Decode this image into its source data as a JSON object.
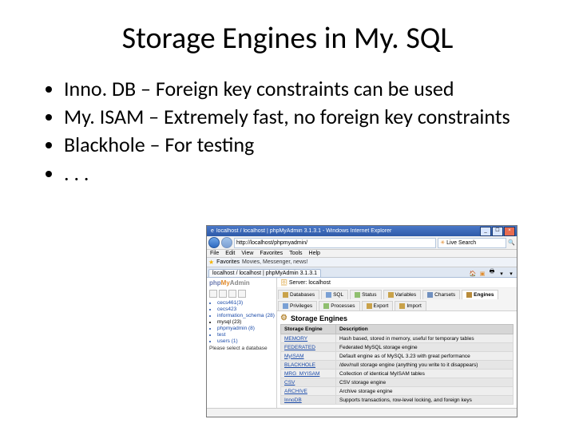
{
  "slide": {
    "title": "Storage Engines in My. SQL",
    "bullets": [
      "Inno. DB – Foreign key constraints can be used",
      "My. ISAM – Extremely fast, no foreign key constraints",
      "Blackhole – For testing",
      ". . ."
    ]
  },
  "window": {
    "title": "localhost / localhost | phpMyAdmin 3.1.3.1 - Windows Internet Explorer",
    "address": "http://localhost/phpmyadmin/",
    "search_placeholder": "Live Search",
    "menus": [
      "File",
      "Edit",
      "View",
      "Favorites",
      "Tools",
      "Help"
    ],
    "fav_label": "Favorites",
    "fav_hint": "Movies, Messenger, news!",
    "tab_label": "localhost / localhost | phpMyAdmin 3.1.3.1"
  },
  "sidebar": {
    "dbs": [
      "cecs461(3)",
      "cecs423",
      "information_schema (28)",
      "mysql (23)",
      "phpmyadmin (8)",
      "test",
      "users (1)"
    ],
    "select_prompt": "Please select a database"
  },
  "crumb": {
    "label": "Server: localhost"
  },
  "tabs": [
    "Databases",
    "SQL",
    "Status",
    "Variables",
    "Charsets",
    "Engines",
    "Privileges",
    "Processes",
    "Export",
    "Import"
  ],
  "engines_heading": "Storage Engines",
  "table": {
    "headers": [
      "Storage Engine",
      "Description"
    ],
    "rows": [
      [
        "MEMORY",
        "Hash based, stored in memory, useful for temporary tables"
      ],
      [
        "FEDERATED",
        "Federated MySQL storage engine"
      ],
      [
        "MyISAM",
        "Default engine as of MySQL 3.23 with great performance"
      ],
      [
        "BLACKHOLE",
        "/dev/null storage engine (anything you write to it disappears)"
      ],
      [
        "MRG_MYISAM",
        "Collection of identical MyISAM tables"
      ],
      [
        "CSV",
        "CSV storage engine"
      ],
      [
        "ARCHIVE",
        "Archive storage engine"
      ],
      [
        "InnoDB",
        "Supports transactions, row-level locking, and foreign keys"
      ]
    ]
  }
}
